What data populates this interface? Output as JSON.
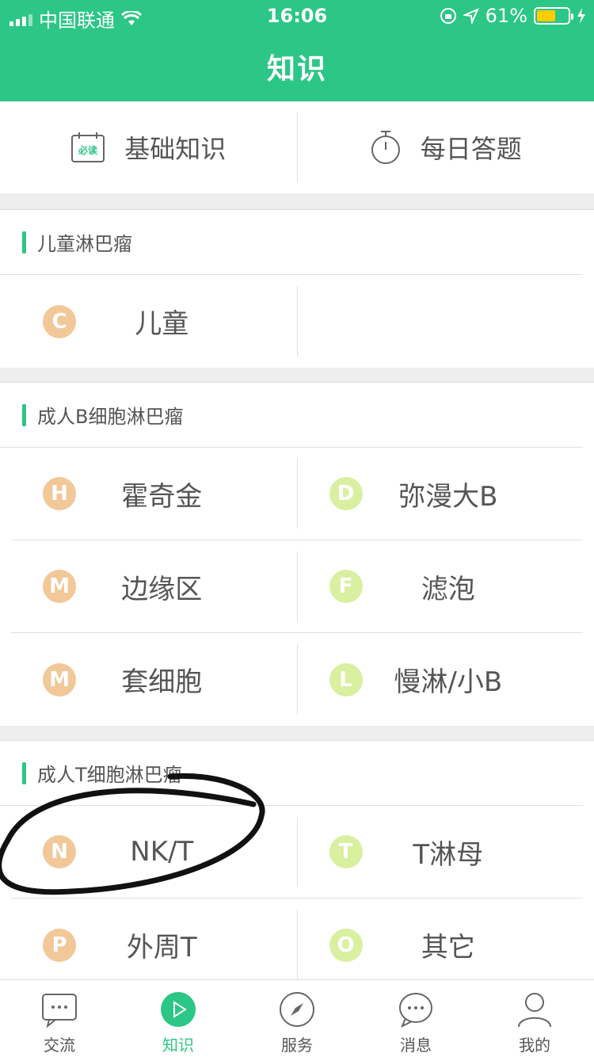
{
  "status": {
    "carrier": "中国联通",
    "time": "16:06",
    "battery_percent": "61%",
    "battery_level": 0.61
  },
  "header": {
    "title": "知识"
  },
  "top": {
    "basic": {
      "label": "基础知识",
      "badge": "必读"
    },
    "daily": {
      "label": "每日答题"
    }
  },
  "sections": [
    {
      "title": "儿童淋巴瘤",
      "rows": [
        [
          {
            "letter": "C",
            "label": "儿童",
            "color": "orange"
          }
        ]
      ]
    },
    {
      "title": "成人B细胞淋巴瘤",
      "rows": [
        [
          {
            "letter": "H",
            "label": "霍奇金",
            "color": "orange"
          },
          {
            "letter": "D",
            "label": "弥漫大B",
            "color": "green"
          }
        ],
        [
          {
            "letter": "M",
            "label": "边缘区",
            "color": "orange"
          },
          {
            "letter": "F",
            "label": "滤泡",
            "color": "green"
          }
        ],
        [
          {
            "letter": "M",
            "label": "套细胞",
            "color": "orange"
          },
          {
            "letter": "L",
            "label": "慢淋/小B",
            "color": "green"
          }
        ]
      ]
    },
    {
      "title": "成人T细胞淋巴瘤",
      "rows": [
        [
          {
            "letter": "N",
            "label": "NK/T",
            "color": "orange"
          },
          {
            "letter": "T",
            "label": "T淋母",
            "color": "green"
          }
        ],
        [
          {
            "letter": "P",
            "label": "外周T",
            "color": "orange"
          },
          {
            "letter": "O",
            "label": "其它",
            "color": "green"
          }
        ]
      ]
    }
  ],
  "tabbar": [
    {
      "label": "交流",
      "icon": "chat-icon"
    },
    {
      "label": "知识",
      "icon": "play-icon",
      "active": true
    },
    {
      "label": "服务",
      "icon": "compass-icon"
    },
    {
      "label": "消息",
      "icon": "message-icon"
    },
    {
      "label": "我的",
      "icon": "user-icon"
    }
  ],
  "colors": {
    "brand": "#2cc686",
    "orange": "#f2c899",
    "green": "#d8f0a0"
  }
}
